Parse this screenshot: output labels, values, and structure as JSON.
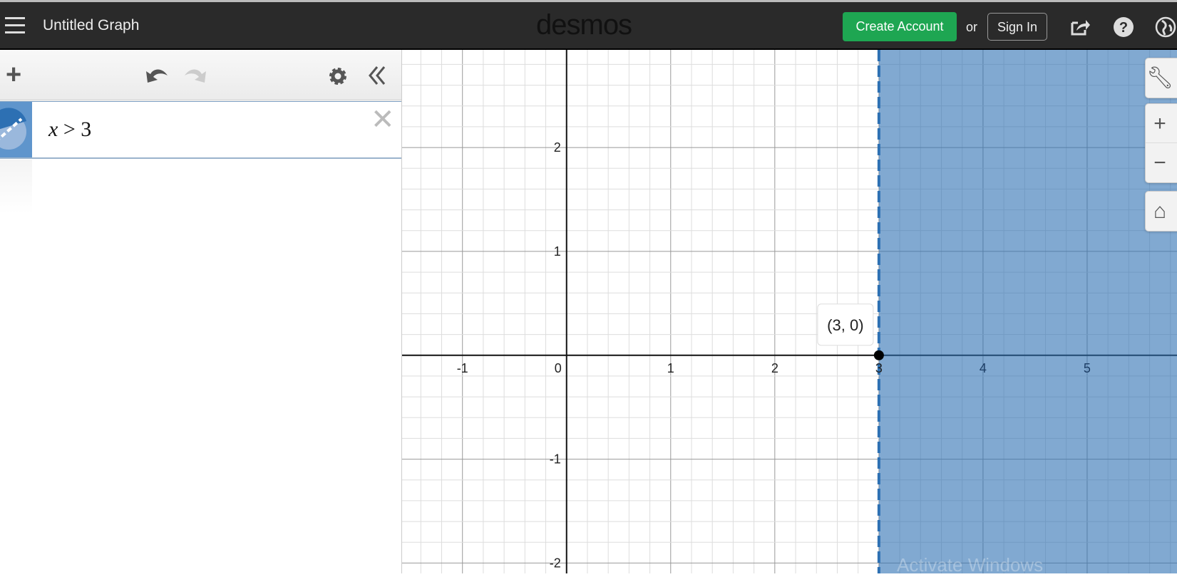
{
  "header": {
    "title": "Untitled Graph",
    "logo": "desmos",
    "create_account": "Create Account",
    "or": "or",
    "sign_in": "Sign In",
    "icons": [
      "menu-icon",
      "share-icon",
      "help-icon",
      "globe-icon"
    ]
  },
  "toolbar": {
    "add": "+",
    "icons": [
      "add-icon",
      "undo-icon",
      "redo-icon",
      "gear-icon",
      "collapse-icon"
    ]
  },
  "expressions": [
    {
      "lhs": "x",
      "op": ">",
      "rhs": "3",
      "color": "#2d70b3",
      "style": "dashed"
    }
  ],
  "graph": {
    "xmin": -1.58,
    "xmax": 5.87,
    "ymin": -2.1,
    "ymax": 2.94,
    "x_ticks": [
      "-1",
      "0",
      "1",
      "2",
      "3",
      "4",
      "5"
    ],
    "y_ticks": [
      "2",
      "1",
      "-1",
      "-2"
    ],
    "grid": true,
    "minor_subdivisions": 5,
    "point_label": "(3, 0)",
    "point": [
      3,
      0
    ],
    "shade_color": "#2d70b3"
  },
  "controls": {
    "zoom_in": "+",
    "zoom_out": "−"
  },
  "watermark": "Activate Windows"
}
